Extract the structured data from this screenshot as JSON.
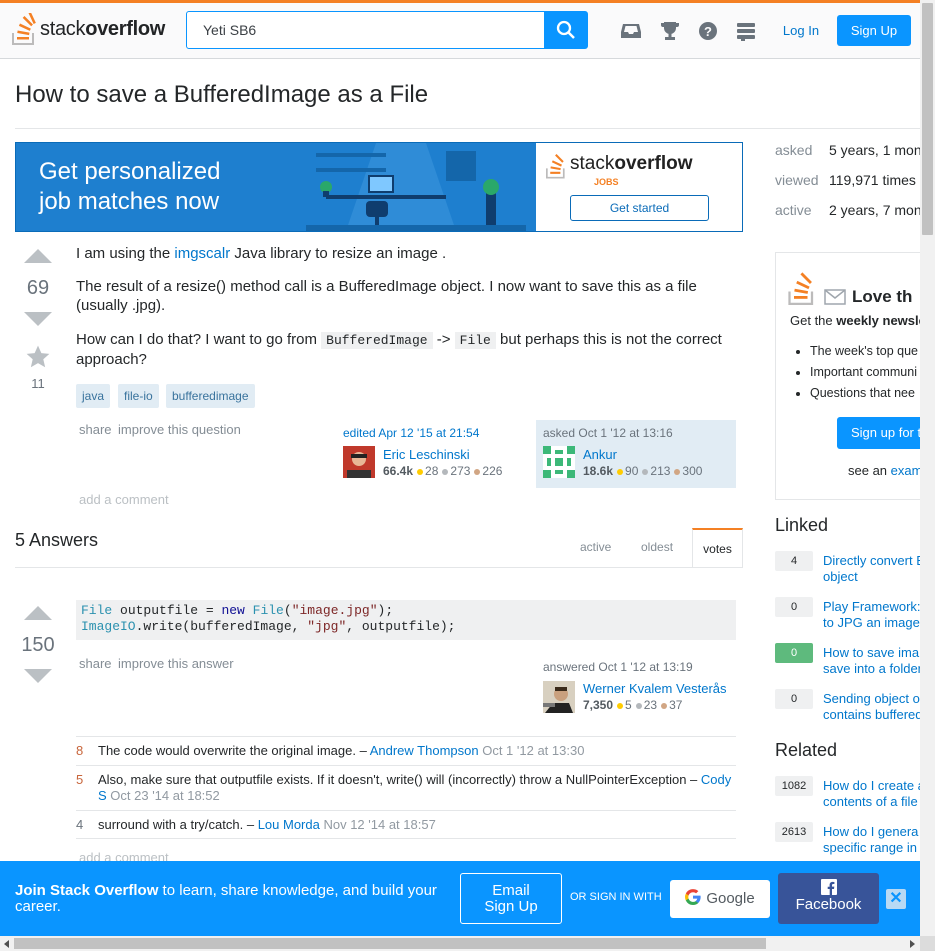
{
  "header": {
    "logo_plain": "stack",
    "logo_bold": "overflow",
    "search_value": "Yeti SB6",
    "login": "Log In",
    "signup": "Sign Up",
    "icons": [
      "inbox-icon",
      "trophy-icon",
      "help-icon",
      "site-switcher-icon"
    ]
  },
  "question": {
    "title": "How to save a BufferedImage as a File",
    "votes": "69",
    "favorites": "11",
    "p1_pre": "I am using the ",
    "p1_link": "imgscalr",
    "p1_post": " Java library to resize an image .",
    "p2": "The result of a resize() method call is a BufferedImage object. I now want to save this as a file (usually .jpg).",
    "p3_pre": "How can I do that? I want to go from ",
    "p3_code1": "BufferedImage",
    "p3_mid": " -> ",
    "p3_code2": "File",
    "p3_post": " but perhaps this is not the correct approach?",
    "tags": [
      "java",
      "file-io",
      "bufferedimage"
    ],
    "share": "share",
    "improve": "improve this question",
    "edited_label": "edited Apr 12 '15 at 21:54",
    "editor": {
      "name": "Eric Leschinski",
      "rep": "66.4k",
      "gold": "28",
      "silver": "273",
      "bronze": "226"
    },
    "asked_label": "asked Oct 1 '12 at 13:16",
    "asker": {
      "name": "Ankur",
      "rep": "18.6k",
      "gold": "90",
      "silver": "213",
      "bronze": "300"
    },
    "add_comment": "add a comment"
  },
  "ad": {
    "headline_1": "Get personalized",
    "headline_2": "job matches now",
    "logo_plain": "stack",
    "logo_bold": "overflow",
    "logo_sub": "JOBS",
    "button": "Get started"
  },
  "answers": {
    "heading": "5 Answers",
    "tabs": {
      "active": "active",
      "oldest": "oldest",
      "votes": "votes"
    },
    "first": {
      "votes": "150",
      "code_line1": {
        "t1": "File",
        "t2": " outputfile = ",
        "t3": "new",
        "t4": " ",
        "t5": "File",
        "t6": "(",
        "t7": "\"image.jpg\"",
        "t8": ");"
      },
      "code_line2": {
        "t1": "ImageIO",
        "t2": ".write(bufferedImage, ",
        "t3": "\"jpg\"",
        "t4": ", outputfile);"
      },
      "share": "share",
      "improve": "improve this answer",
      "answered_label": "answered Oct 1 '12 at 13:19",
      "author": {
        "name": "Werner Kvalem Vesterås",
        "rep": "7,350",
        "gold": "5",
        "silver": "23",
        "bronze": "37"
      },
      "comments": [
        {
          "score": "8",
          "text": "The code would overwrite the original image. – ",
          "user": "Andrew Thompson",
          "date": "Oct 1 '12 at 13:30"
        },
        {
          "score": "5",
          "text": "Also, make sure that outputfile exists. If it doesn't, write() will (incorrectly) throw a NullPointerException – ",
          "user": "Cody S",
          "date": "Oct 23 '14 at 18:52"
        },
        {
          "score": "4",
          "text": "surround with a try/catch. – ",
          "user": "Lou Morda",
          "date": "Nov 12 '14 at 18:57"
        }
      ],
      "add_comment": "add a comment"
    }
  },
  "sidebar": {
    "meta": [
      {
        "label": "asked",
        "value": "5 years, 1 mon"
      },
      {
        "label": "viewed",
        "value": "119,971 times"
      },
      {
        "label": "active",
        "value": "2 years, 7 mon"
      }
    ],
    "newsletter": {
      "title": "Love th",
      "sub_pre": "Get the ",
      "sub_bold": "weekly newsle",
      "bullets": [
        "The week's top que",
        "Important communi",
        "Questions that nee"
      ],
      "button": "Sign up for t",
      "see_pre": "see an ",
      "see_link": "exam"
    },
    "linked_heading": "Linked",
    "linked": [
      {
        "score": "4",
        "accepted": false,
        "l1": "Directly convert B",
        "l2": "object"
      },
      {
        "score": "0",
        "accepted": false,
        "l1": "Play Framework:",
        "l2": "to JPG an image"
      },
      {
        "score": "0",
        "accepted": true,
        "l1": "How to save ima",
        "l2": "save into a folder"
      },
      {
        "score": "0",
        "accepted": false,
        "l1": "Sending object o",
        "l2": "contains buffered"
      }
    ],
    "related_heading": "Related",
    "related": [
      {
        "score": "1082",
        "l1": "How do I create a",
        "l2": "contents of a file"
      },
      {
        "score": "2613",
        "l1": "How do I genera",
        "l2": "specific range in"
      }
    ]
  },
  "banner": {
    "bold": "Join Stack Overflow",
    "rest": " to learn, share knowledge, and build your career.",
    "email_1": "Email",
    "email_2": "Sign Up",
    "or": "OR SIGN IN WITH",
    "google": "Google",
    "facebook": "Facebook",
    "close": "✕"
  }
}
